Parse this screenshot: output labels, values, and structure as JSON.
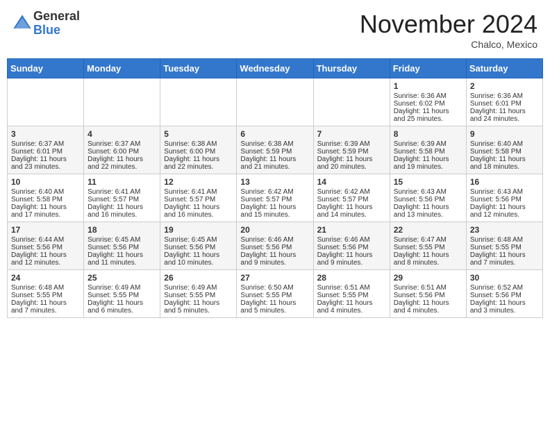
{
  "header": {
    "logo_general": "General",
    "logo_blue": "Blue",
    "month_title": "November 2024",
    "location": "Chalco, Mexico"
  },
  "weekdays": [
    "Sunday",
    "Monday",
    "Tuesday",
    "Wednesday",
    "Thursday",
    "Friday",
    "Saturday"
  ],
  "weeks": [
    [
      {
        "day": "",
        "sunrise": "",
        "sunset": "",
        "daylight": ""
      },
      {
        "day": "",
        "sunrise": "",
        "sunset": "",
        "daylight": ""
      },
      {
        "day": "",
        "sunrise": "",
        "sunset": "",
        "daylight": ""
      },
      {
        "day": "",
        "sunrise": "",
        "sunset": "",
        "daylight": ""
      },
      {
        "day": "",
        "sunrise": "",
        "sunset": "",
        "daylight": ""
      },
      {
        "day": "1",
        "sunrise": "Sunrise: 6:36 AM",
        "sunset": "Sunset: 6:02 PM",
        "daylight": "Daylight: 11 hours and 25 minutes."
      },
      {
        "day": "2",
        "sunrise": "Sunrise: 6:36 AM",
        "sunset": "Sunset: 6:01 PM",
        "daylight": "Daylight: 11 hours and 24 minutes."
      }
    ],
    [
      {
        "day": "3",
        "sunrise": "Sunrise: 6:37 AM",
        "sunset": "Sunset: 6:01 PM",
        "daylight": "Daylight: 11 hours and 23 minutes."
      },
      {
        "day": "4",
        "sunrise": "Sunrise: 6:37 AM",
        "sunset": "Sunset: 6:00 PM",
        "daylight": "Daylight: 11 hours and 22 minutes."
      },
      {
        "day": "5",
        "sunrise": "Sunrise: 6:38 AM",
        "sunset": "Sunset: 6:00 PM",
        "daylight": "Daylight: 11 hours and 22 minutes."
      },
      {
        "day": "6",
        "sunrise": "Sunrise: 6:38 AM",
        "sunset": "Sunset: 5:59 PM",
        "daylight": "Daylight: 11 hours and 21 minutes."
      },
      {
        "day": "7",
        "sunrise": "Sunrise: 6:39 AM",
        "sunset": "Sunset: 5:59 PM",
        "daylight": "Daylight: 11 hours and 20 minutes."
      },
      {
        "day": "8",
        "sunrise": "Sunrise: 6:39 AM",
        "sunset": "Sunset: 5:58 PM",
        "daylight": "Daylight: 11 hours and 19 minutes."
      },
      {
        "day": "9",
        "sunrise": "Sunrise: 6:40 AM",
        "sunset": "Sunset: 5:58 PM",
        "daylight": "Daylight: 11 hours and 18 minutes."
      }
    ],
    [
      {
        "day": "10",
        "sunrise": "Sunrise: 6:40 AM",
        "sunset": "Sunset: 5:58 PM",
        "daylight": "Daylight: 11 hours and 17 minutes."
      },
      {
        "day": "11",
        "sunrise": "Sunrise: 6:41 AM",
        "sunset": "Sunset: 5:57 PM",
        "daylight": "Daylight: 11 hours and 16 minutes."
      },
      {
        "day": "12",
        "sunrise": "Sunrise: 6:41 AM",
        "sunset": "Sunset: 5:57 PM",
        "daylight": "Daylight: 11 hours and 16 minutes."
      },
      {
        "day": "13",
        "sunrise": "Sunrise: 6:42 AM",
        "sunset": "Sunset: 5:57 PM",
        "daylight": "Daylight: 11 hours and 15 minutes."
      },
      {
        "day": "14",
        "sunrise": "Sunrise: 6:42 AM",
        "sunset": "Sunset: 5:57 PM",
        "daylight": "Daylight: 11 hours and 14 minutes."
      },
      {
        "day": "15",
        "sunrise": "Sunrise: 6:43 AM",
        "sunset": "Sunset: 5:56 PM",
        "daylight": "Daylight: 11 hours and 13 minutes."
      },
      {
        "day": "16",
        "sunrise": "Sunrise: 6:43 AM",
        "sunset": "Sunset: 5:56 PM",
        "daylight": "Daylight: 11 hours and 12 minutes."
      }
    ],
    [
      {
        "day": "17",
        "sunrise": "Sunrise: 6:44 AM",
        "sunset": "Sunset: 5:56 PM",
        "daylight": "Daylight: 11 hours and 12 minutes."
      },
      {
        "day": "18",
        "sunrise": "Sunrise: 6:45 AM",
        "sunset": "Sunset: 5:56 PM",
        "daylight": "Daylight: 11 hours and 11 minutes."
      },
      {
        "day": "19",
        "sunrise": "Sunrise: 6:45 AM",
        "sunset": "Sunset: 5:56 PM",
        "daylight": "Daylight: 11 hours and 10 minutes."
      },
      {
        "day": "20",
        "sunrise": "Sunrise: 6:46 AM",
        "sunset": "Sunset: 5:56 PM",
        "daylight": "Daylight: 11 hours and 9 minutes."
      },
      {
        "day": "21",
        "sunrise": "Sunrise: 6:46 AM",
        "sunset": "Sunset: 5:56 PM",
        "daylight": "Daylight: 11 hours and 9 minutes."
      },
      {
        "day": "22",
        "sunrise": "Sunrise: 6:47 AM",
        "sunset": "Sunset: 5:55 PM",
        "daylight": "Daylight: 11 hours and 8 minutes."
      },
      {
        "day": "23",
        "sunrise": "Sunrise: 6:48 AM",
        "sunset": "Sunset: 5:55 PM",
        "daylight": "Daylight: 11 hours and 7 minutes."
      }
    ],
    [
      {
        "day": "24",
        "sunrise": "Sunrise: 6:48 AM",
        "sunset": "Sunset: 5:55 PM",
        "daylight": "Daylight: 11 hours and 7 minutes."
      },
      {
        "day": "25",
        "sunrise": "Sunrise: 6:49 AM",
        "sunset": "Sunset: 5:55 PM",
        "daylight": "Daylight: 11 hours and 6 minutes."
      },
      {
        "day": "26",
        "sunrise": "Sunrise: 6:49 AM",
        "sunset": "Sunset: 5:55 PM",
        "daylight": "Daylight: 11 hours and 5 minutes."
      },
      {
        "day": "27",
        "sunrise": "Sunrise: 6:50 AM",
        "sunset": "Sunset: 5:55 PM",
        "daylight": "Daylight: 11 hours and 5 minutes."
      },
      {
        "day": "28",
        "sunrise": "Sunrise: 6:51 AM",
        "sunset": "Sunset: 5:55 PM",
        "daylight": "Daylight: 11 hours and 4 minutes."
      },
      {
        "day": "29",
        "sunrise": "Sunrise: 6:51 AM",
        "sunset": "Sunset: 5:56 PM",
        "daylight": "Daylight: 11 hours and 4 minutes."
      },
      {
        "day": "30",
        "sunrise": "Sunrise: 6:52 AM",
        "sunset": "Sunset: 5:56 PM",
        "daylight": "Daylight: 11 hours and 3 minutes."
      }
    ]
  ]
}
